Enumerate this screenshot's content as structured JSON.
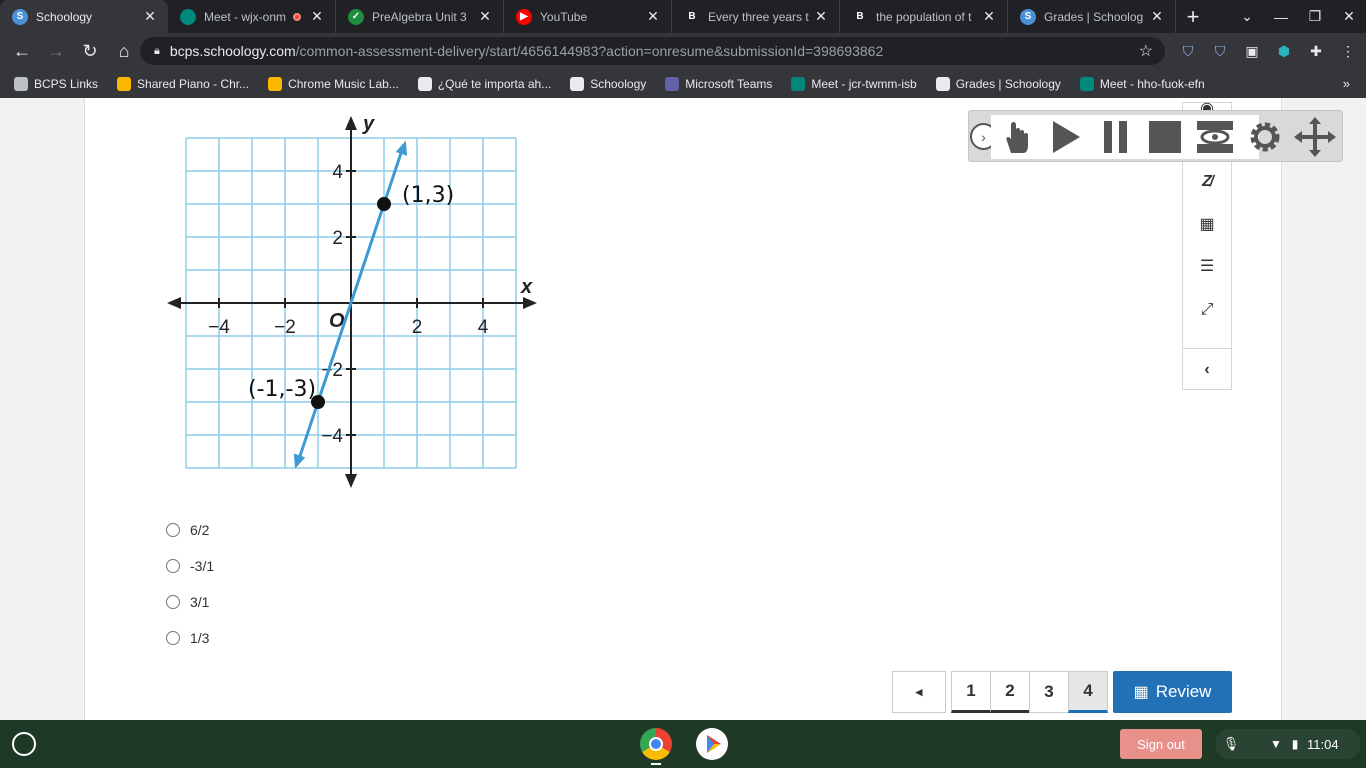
{
  "browser": {
    "tabs": [
      {
        "title": "Schoology",
        "icon": "schoology-icon",
        "color": "#4a90d9",
        "letter": "S",
        "active": true
      },
      {
        "title": "Meet - wjx-onm",
        "icon": "google-meet-icon",
        "color": "#00897b",
        "letter": "",
        "recording": true
      },
      {
        "title": "PreAlgebra Unit 3",
        "icon": "classroom-icon",
        "color": "#1e8e3e",
        "letter": "✓"
      },
      {
        "title": "YouTube",
        "icon": "youtube-icon",
        "color": "#ff0000",
        "letter": "▶"
      },
      {
        "title": "Every three years t",
        "icon": "brainly-icon",
        "color": "#202124",
        "letter": "B"
      },
      {
        "title": "the population of t",
        "icon": "brainly-icon",
        "color": "#202124",
        "letter": "B"
      },
      {
        "title": "Grades | Schoolog",
        "icon": "schoology-icon",
        "color": "#4a90d9",
        "letter": "S"
      }
    ],
    "new_tab_label": "+",
    "url_host": "bcps.schoology.com",
    "url_path": "/common-assessment-delivery/start/4656144983?action=onresume&submissionId=398693862",
    "bookmarks": [
      {
        "label": "BCPS Links",
        "icon": "folder-icon",
        "color": "#bdc1c6"
      },
      {
        "label": "Shared Piano - Chr...",
        "icon": "chrome-music-lab-icon",
        "color": "#f9b700"
      },
      {
        "label": "Chrome Music Lab...",
        "icon": "chrome-music-lab-icon",
        "color": "#f9b700"
      },
      {
        "label": "¿Qué te importa ah...",
        "icon": "schoology-icon",
        "color": "#e8eaed"
      },
      {
        "label": "Schoology",
        "icon": "schoology-icon",
        "color": "#e8eaed"
      },
      {
        "label": "Microsoft Teams",
        "icon": "teams-icon",
        "color": "#6264a7"
      },
      {
        "label": "Meet - jcr-twmm-isb",
        "icon": "google-meet-icon",
        "color": "#00897b"
      },
      {
        "label": "Grades | Schoology",
        "icon": "schoology-icon",
        "color": "#e8eaed"
      },
      {
        "label": "Meet - hho-fuok-efn",
        "icon": "google-meet-icon",
        "color": "#00897b"
      }
    ],
    "bookmarks_overflow": "»"
  },
  "question": {
    "graph": {
      "axis_x_label": "x",
      "axis_y_label": "y",
      "origin_label": "O",
      "x_ticks": [
        "−4",
        "−2",
        "2",
        "4"
      ],
      "y_ticks": [
        "4",
        "2",
        "−2",
        "−4"
      ],
      "points": [
        {
          "label": "(1,3)",
          "x": 1,
          "y": 3
        },
        {
          "label": "(-1,-3)",
          "x": -1,
          "y": -3
        }
      ],
      "line_color": "#3d9bd6",
      "grid_color": "#8fcde8"
    },
    "choices": [
      {
        "label": "6/2",
        "selected": false
      },
      {
        "label": "-3/1",
        "selected": false
      },
      {
        "label": "3/1",
        "selected": false
      },
      {
        "label": "1/3",
        "selected": false
      }
    ]
  },
  "pagination": {
    "prev_label": "◂",
    "pages": [
      "1",
      "2",
      "3",
      "4"
    ],
    "current_page": "4",
    "review_label": "Review"
  },
  "shelf": {
    "sign_out_label": "Sign out",
    "time": "11:04"
  }
}
